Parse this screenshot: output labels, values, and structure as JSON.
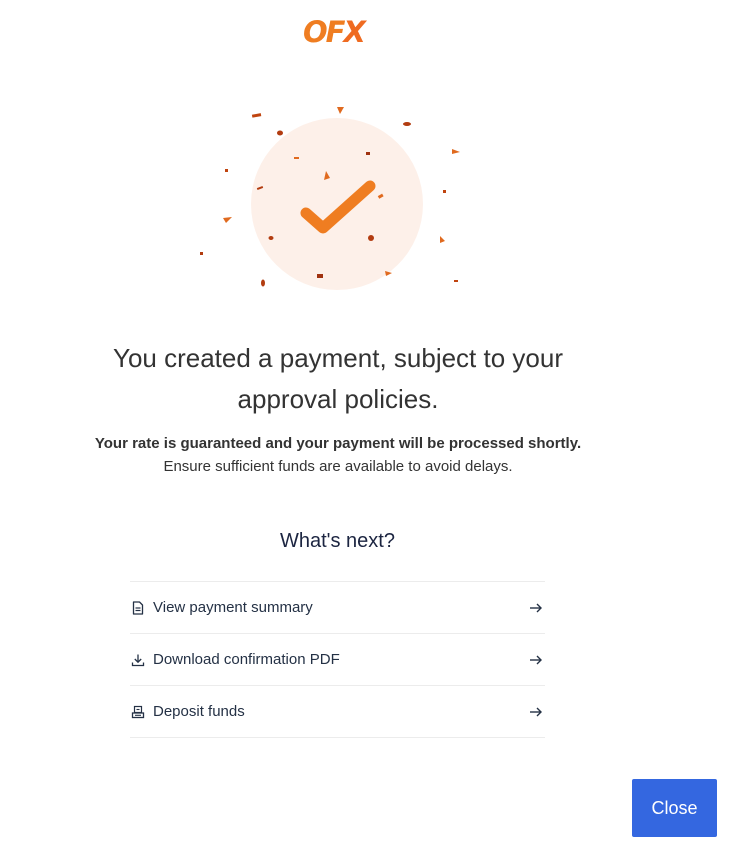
{
  "brand": {
    "logo_text_o_f": "OF",
    "logo_text_x": "X",
    "color": "#ef7d21"
  },
  "success_icon": "checkmark-icon",
  "title": "You created a payment, subject to your approval policies.",
  "subtitle": {
    "bold": "Your rate is guaranteed and your payment will be processed shortly.",
    "regular": "Ensure sufficient funds are available to avoid delays."
  },
  "next": {
    "heading": "What's next?",
    "items": [
      {
        "label": "View payment summary",
        "icon": "document-icon"
      },
      {
        "label": "Download confirmation PDF",
        "icon": "download-icon"
      },
      {
        "label": "Deposit funds",
        "icon": "deposit-icon"
      }
    ]
  },
  "close_button": {
    "label": "Close",
    "color": "#3467e0"
  }
}
